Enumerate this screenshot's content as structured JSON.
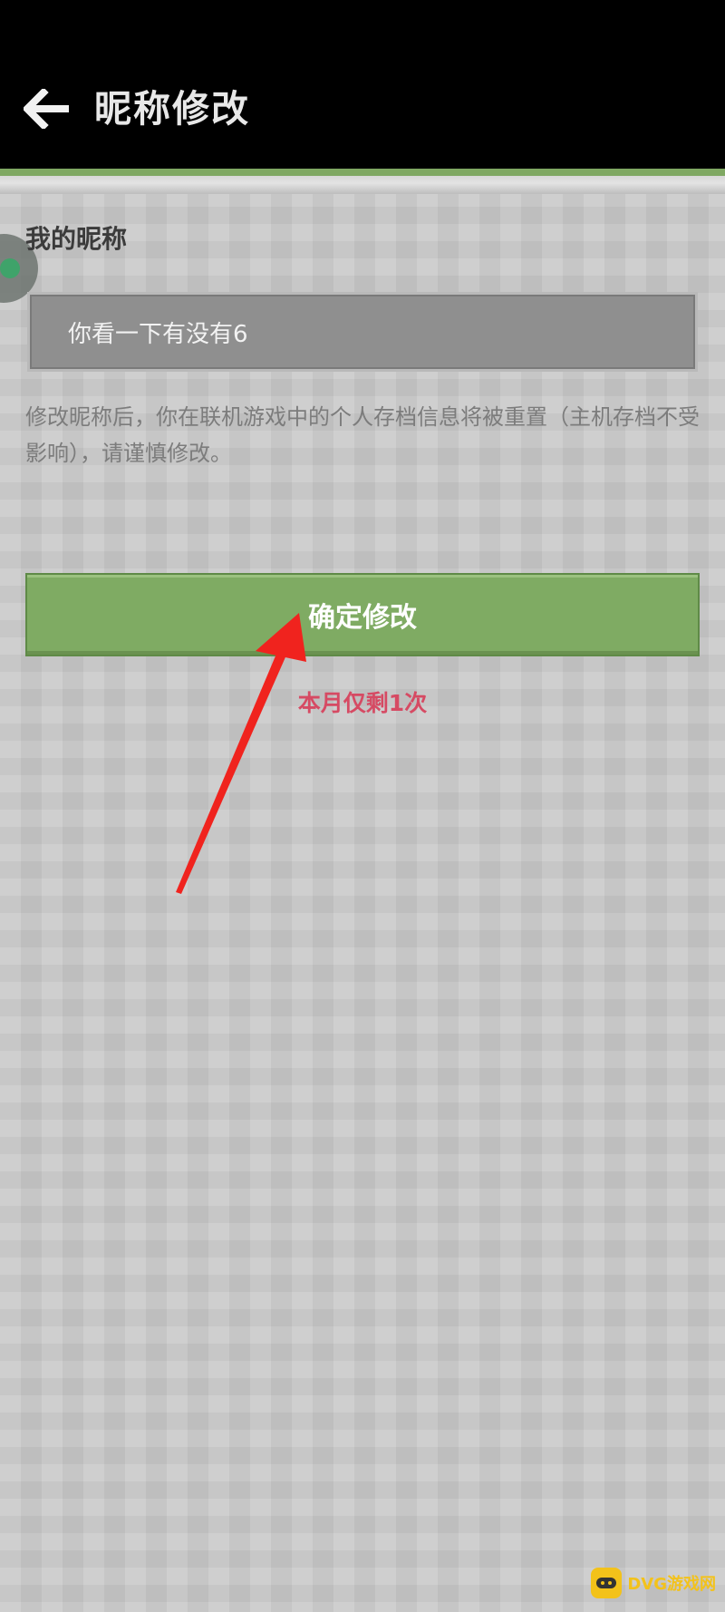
{
  "header": {
    "title": "昵称修改",
    "back_icon": "arrow-left-icon"
  },
  "form": {
    "section_label": "我的昵称",
    "nickname_value": "你看一下有没有6",
    "notice": "修改昵称后，你在联机游戏中的个人存档信息将被重置（主机存档不受影响），请谨慎修改。",
    "confirm_label": "确定修改",
    "remaining_text": "本月仅剩1次"
  },
  "watermark": {
    "text": "DVG游戏网"
  },
  "colors": {
    "header_bg": "#000000",
    "accent_green": "#7fab63",
    "remaining_red": "#d64a63",
    "arrow_red": "#f0231e"
  }
}
